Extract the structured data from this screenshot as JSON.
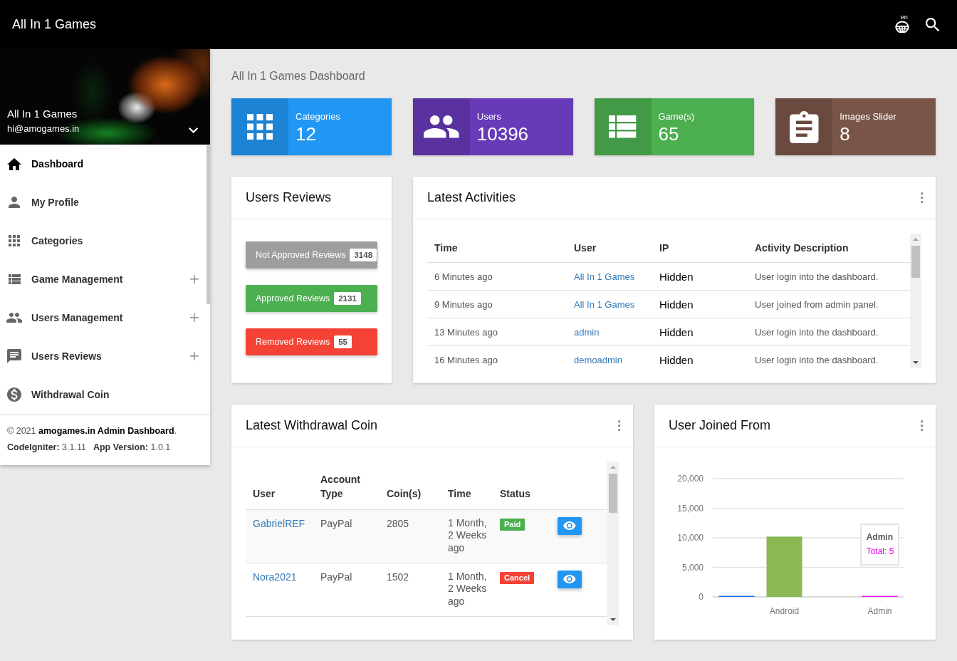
{
  "top_bar": {
    "title": "All In 1 Games",
    "language": "en"
  },
  "sidebar": {
    "profile": {
      "name": "All In 1 Games",
      "email": "hi@amogames.in"
    },
    "items": [
      {
        "label": "Dashboard",
        "selected": true,
        "expandable": false
      },
      {
        "label": "My Profile",
        "selected": false,
        "expandable": false
      },
      {
        "label": "Categories",
        "selected": false,
        "expandable": false
      },
      {
        "label": "Game Management",
        "selected": false,
        "expandable": true
      },
      {
        "label": "Users Management",
        "selected": false,
        "expandable": true
      },
      {
        "label": "Users Reviews",
        "selected": false,
        "expandable": true
      },
      {
        "label": "Withdrawal Coin",
        "selected": false,
        "expandable": false
      }
    ],
    "footer": {
      "copyright": "© 2021 **amogames.in Admin Dashboard**.",
      "versions": [
        "**CodeIgniter:** 3.1.11",
        "**App Version:** 1.0.1"
      ]
    }
  },
  "page_title": "All In 1 Games Dashboard",
  "stats": [
    {
      "label": "Categories",
      "value": "12",
      "color": "#2196f3"
    },
    {
      "label": "Users",
      "value": "10396",
      "color": "#673ab7"
    },
    {
      "label": "Game(s)",
      "value": "65",
      "color": "#4caf50"
    },
    {
      "label": "Images Slider",
      "value": "8",
      "color": "#795548"
    }
  ],
  "users_reviews": {
    "title": "Users Reviews",
    "buttons": [
      {
        "label": "Not Approved Reviews",
        "count": "3148",
        "color": "#9e9e9e"
      },
      {
        "label": "Approved Reviews",
        "count": "2131",
        "color": "#4caf50"
      },
      {
        "label": "Removed Reviews",
        "count": "55",
        "color": "#f44336"
      }
    ]
  },
  "latest_activities": {
    "title": "Latest Activities",
    "columns": [
      "Time",
      "User",
      "IP",
      "Activity Description"
    ],
    "rows": [
      {
        "time": "6 Minutes ago",
        "user": "All In 1 Games",
        "ip": "Hidden",
        "description": "User login into the dashboard."
      },
      {
        "time": "9 Minutes ago",
        "user": "All In 1 Games",
        "ip": "Hidden",
        "description": "User joined from admin panel."
      },
      {
        "time": "13 Minutes ago",
        "user": "admin",
        "ip": "Hidden",
        "description": "User login into the dashboard."
      },
      {
        "time": "16 Minutes ago",
        "user": "demoadmin",
        "ip": "Hidden",
        "description": "User login into the dashboard."
      }
    ]
  },
  "latest_withdrawal": {
    "title": "Latest Withdrawal Coin",
    "columns": [
      "User",
      "Account Type",
      "Coin(s)",
      "Time",
      "Status"
    ],
    "rows": [
      {
        "user": "GabrielREF",
        "account_type": "PayPal",
        "coins": "2805",
        "time": "1 Month, 2 Weeks ago",
        "status": {
          "label": "Paid",
          "color": "#4caf50"
        }
      },
      {
        "user": "Nora2021",
        "account_type": "PayPal",
        "coins": "1502",
        "time": "1 Month, 2 Weeks ago",
        "status": {
          "label": "Cancel",
          "color": "#f44336"
        }
      }
    ]
  },
  "user_joined": {
    "title": "User Joined From",
    "chart_data": {
      "type": "bar",
      "categories": [
        null,
        "Android",
        null,
        "Admin"
      ],
      "series": [
        {
          "values": [
            100,
            10200,
            0,
            5
          ],
          "colors": [
            "#1a6fe8",
            "#8bb852",
            null,
            "#e61ee6"
          ]
        }
      ],
      "ylim": [
        0,
        20000
      ],
      "yticks": [
        {
          "value": 0,
          "label": "0"
        },
        {
          "value": 5000,
          "label": "5,000"
        },
        {
          "value": 10000,
          "label": "10,000"
        },
        {
          "value": 15000,
          "label": "15,000"
        },
        {
          "value": 20000,
          "label": "20,000"
        }
      ],
      "grid": true
    },
    "tooltip": {
      "title": "Admin",
      "text": "Total: 5"
    }
  }
}
